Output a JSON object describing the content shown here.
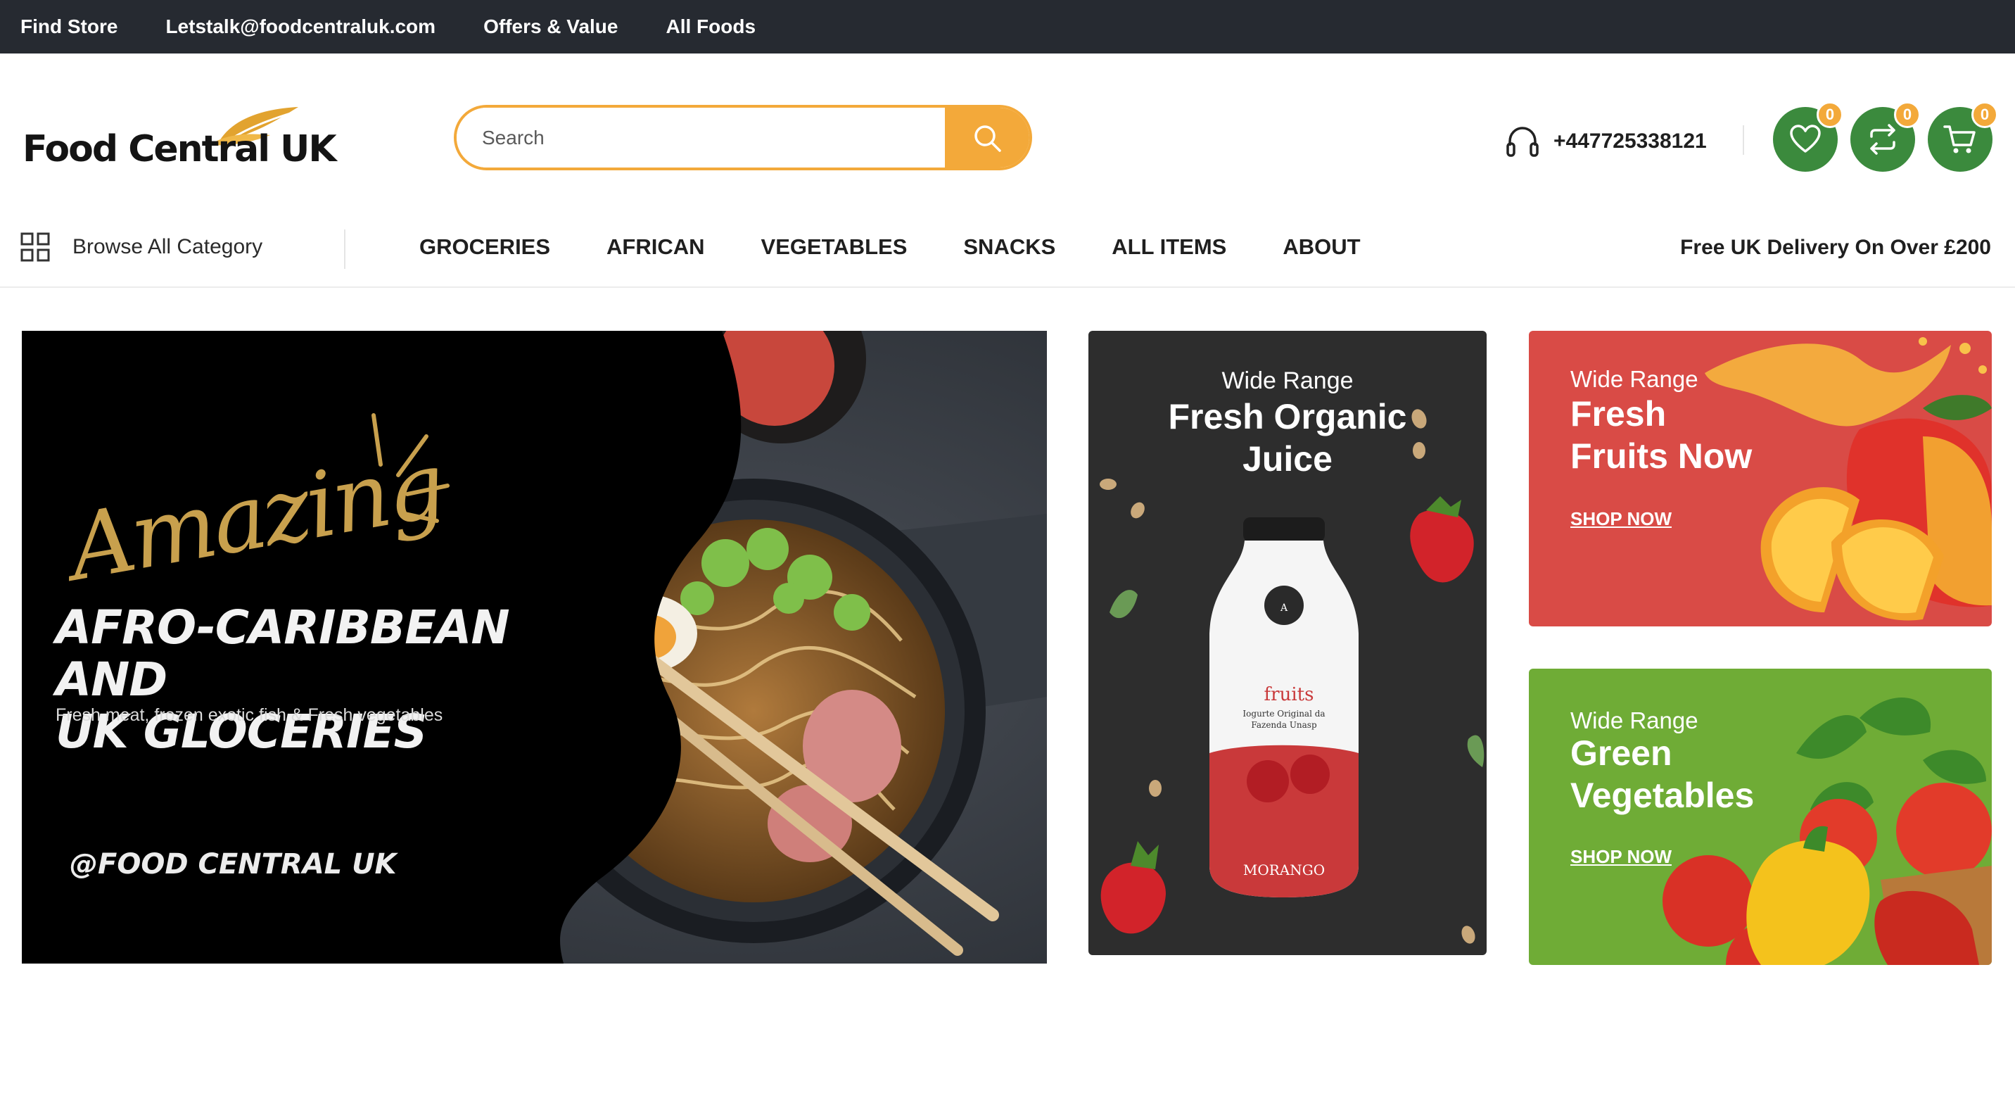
{
  "topbar": {
    "links": [
      "Find Store",
      "Letstalk@foodcentraluk.com",
      "Offers & Value",
      "All Foods"
    ]
  },
  "header": {
    "logo_text": "Food Central UK",
    "search_placeholder": "Search",
    "phone": "+447725338121",
    "wishlist_count": "0",
    "compare_count": "0",
    "cart_count": "0"
  },
  "nav": {
    "browse_label": "Browse All Category",
    "items": [
      "GROCERIES",
      "AFRICAN",
      "VEGETABLES",
      "SNACKS",
      "ALL ITEMS",
      "ABOUT"
    ],
    "delivery_text": "Free UK Delivery On Over £200"
  },
  "hero": {
    "script_word": "Amazing",
    "title_line1": "AFRO-CARIBBEAN AND",
    "title_line2": "UK GLOCERIES",
    "subtitle": "Fresh meat, frozen exotic fish & Fresh vegetables",
    "handle": "@FOOD CENTRAL UK"
  },
  "juice_card": {
    "kicker": "Wide Range",
    "title_line1": "Fresh Organic",
    "title_line2": "Juice",
    "bottle_label": "fruits",
    "bottle_subtext": "Iogurte Original da Fazenda Unasp",
    "bottle_flavor": "MORANGO"
  },
  "fruits_card": {
    "kicker": "Wide Range",
    "title_line1": "Fresh",
    "title_line2": "Fruits Now",
    "cta": "SHOP NOW"
  },
  "greens_card": {
    "kicker": "Wide Range",
    "title_line1": "Green",
    "title_line2": "Vegetables",
    "cta": "SHOP NOW"
  },
  "colors": {
    "topbar_bg": "#262a31",
    "accent_orange": "#f3a93a",
    "brand_green": "#3b8a3d",
    "fruits_red": "#d94b46",
    "greens_green": "#6fac36",
    "juice_dark": "#2d2d2d"
  },
  "icons": [
    "search-icon",
    "headset-icon",
    "heart-icon",
    "compare-icon",
    "cart-icon",
    "grid-icon",
    "leaf-icon"
  ]
}
